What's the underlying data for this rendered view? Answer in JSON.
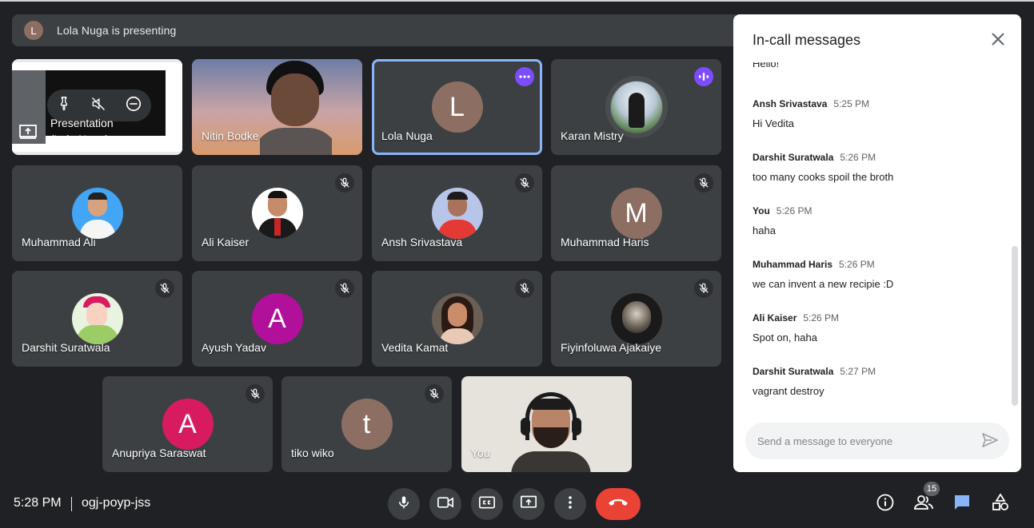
{
  "banner": {
    "avatar_letter": "L",
    "text": "Lola Nuga is presenting"
  },
  "presentation": {
    "label_line1": "Presentation",
    "label_line2": "(Lola Nuga)"
  },
  "tiles": {
    "nitin": {
      "name": "Nitin Bodke"
    },
    "lola": {
      "name": "Lola Nuga",
      "letter": "L",
      "color": "#8d6e63"
    },
    "karan": {
      "name": "Karan Mistry"
    },
    "muhammad_ali": {
      "name": "Muhammad Ali"
    },
    "ali_kaiser": {
      "name": "Ali Kaiser"
    },
    "ansh": {
      "name": "Ansh Srivastava"
    },
    "muhammad_haris": {
      "name": "Muhammad Haris",
      "letter": "M",
      "color": "#8d6e63"
    },
    "darshit": {
      "name": "Darshit Suratwala"
    },
    "ayush": {
      "name": "Ayush Yadav",
      "letter": "A",
      "color": "#c2185b"
    },
    "vedita": {
      "name": "Vedita Kamat"
    },
    "fiyin": {
      "name": "Fiyinfoluwa Ajakaiye"
    },
    "anupriya": {
      "name": "Anupriya Saraswat",
      "letter": "A",
      "color": "#d81b60"
    },
    "tiko": {
      "name": "tiko wiko",
      "letter": "t",
      "color": "#8d6e63"
    },
    "you": {
      "name": "You"
    }
  },
  "chat": {
    "title": "In-call messages",
    "partial": "Hello!",
    "messages": [
      {
        "sender": "Ansh Srivastava",
        "time": "5:25 PM",
        "text": "Hi Vedita"
      },
      {
        "sender": "Darshit Suratwala",
        "time": "5:26 PM",
        "text": "too many cooks spoil the broth"
      },
      {
        "sender": "You",
        "time": "5:26 PM",
        "text": "haha"
      },
      {
        "sender": "Muhammad Haris",
        "time": "5:26 PM",
        "text": "we can invent a new recipie :D"
      },
      {
        "sender": "Ali Kaiser",
        "time": "5:26 PM",
        "text": "Spot on, haha"
      },
      {
        "sender": "Darshit Suratwala",
        "time": "5:27 PM",
        "text": "vagrant destroy"
      }
    ],
    "input_placeholder": "Send a message to everyone"
  },
  "bottom": {
    "time": "5:28 PM",
    "meeting_code": "ogj-poyp-jss",
    "participant_count": "15"
  },
  "colors": {
    "accent": "#8ab4f8",
    "hangup": "#ea4335",
    "tile_bg": "#3c4043",
    "bg": "#202124"
  },
  "icons": [
    "pin-icon",
    "mute-icon",
    "remove-icon",
    "present-icon",
    "mic-off-icon",
    "more-icon",
    "speaking-icon",
    "close-icon",
    "send-icon",
    "mic-icon",
    "camera-icon",
    "captions-icon",
    "present-now-icon",
    "more-options-icon",
    "hangup-icon",
    "info-icon",
    "people-icon",
    "chat-icon",
    "activities-icon"
  ]
}
